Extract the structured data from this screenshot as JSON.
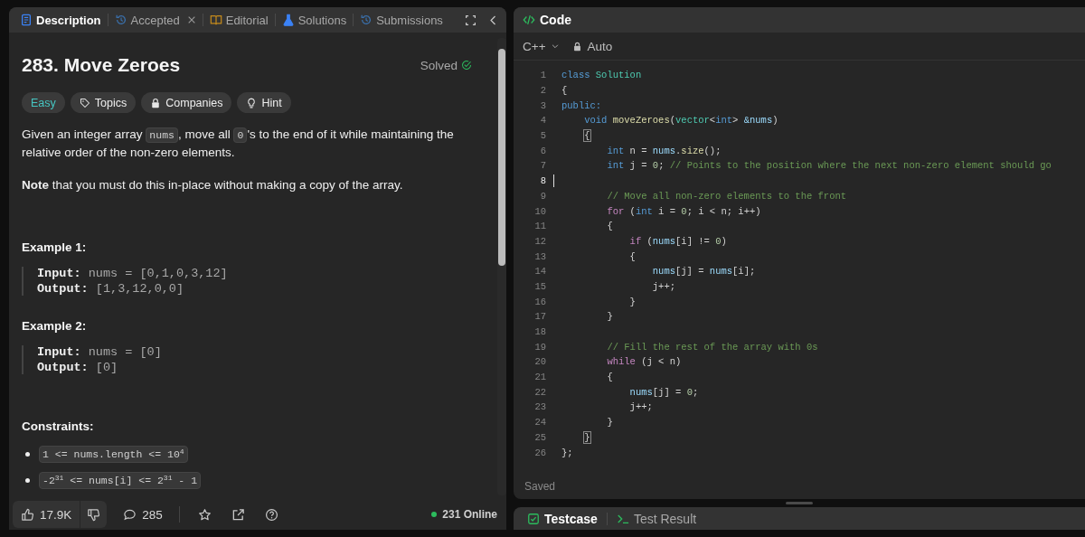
{
  "left_panel": {
    "tabs": [
      {
        "label": "Description",
        "selected": true,
        "closable": false
      },
      {
        "label": "Accepted",
        "selected": false,
        "closable": true
      },
      {
        "label": "Editorial",
        "selected": false,
        "closable": false
      },
      {
        "label": "Solutions",
        "selected": false,
        "closable": false
      },
      {
        "label": "Submissions",
        "selected": false,
        "closable": false
      }
    ],
    "problem": {
      "title": "283. Move Zeroes",
      "status": "Solved",
      "tags": [
        {
          "label": "Easy",
          "kind": "difficulty"
        },
        {
          "label": "Topics",
          "kind": "tag"
        },
        {
          "label": "Companies",
          "kind": "lock"
        },
        {
          "label": "Hint",
          "kind": "bulb"
        }
      ],
      "description": [
        {
          "kind": "paragraph",
          "segments": [
            {
              "kind": "text",
              "text": "Given an integer array "
            },
            {
              "kind": "code",
              "text": "nums"
            },
            {
              "kind": "text",
              "text": ", move all "
            },
            {
              "kind": "code",
              "text": "0"
            },
            {
              "kind": "text",
              "text": "'s to the end of it while maintaining the relative order of the non-zero elements."
            }
          ]
        },
        {
          "kind": "paragraph",
          "segments": [
            {
              "kind": "text",
              "text": "**Note** that you must do this in-place without making a copy of the array."
            }
          ]
        }
      ],
      "examples": [
        {
          "title": "Example 1:",
          "lines": [
            {
              "label": "Input:",
              "value": "nums = [0,1,0,3,12]"
            },
            {
              "label": "Output:",
              "value": "[1,3,12,0,0]"
            }
          ]
        },
        {
          "title": "Example 2:",
          "lines": [
            {
              "label": "Input:",
              "value": "nums = [0]"
            },
            {
              "label": "Output:",
              "value": "[0]"
            }
          ]
        }
      ],
      "constraints_title": "Constraints:",
      "constraints": [
        "1 <= nums.length <= 10$^{4}$",
        "-2$^{31}$ <= nums[i] <= 2$^{31}$ - 1"
      ]
    },
    "footer": {
      "likes": "17.9K",
      "comments": "285",
      "online": "231 Online"
    }
  },
  "code_panel": {
    "title": "Code",
    "language": "C++",
    "mode": "Auto",
    "status": "Saved",
    "lines": [
      {
        "number": "1",
        "active": false,
        "tokens": [
          {
            "kind": "keyword",
            "text": "class"
          },
          {
            "kind": "type",
            "text": " Solution"
          }
        ]
      },
      {
        "number": "2",
        "active": false,
        "tokens": [
          {
            "kind": "plain",
            "text": "{"
          }
        ]
      },
      {
        "number": "3",
        "active": false,
        "tokens": [
          {
            "kind": "keyword",
            "text": "public:"
          }
        ],
        "children": [
          {
            "number": "4",
            "active": false,
            "tokens": [
              {
                "kind": "keyword",
                "text": "void"
              },
              {
                "kind": "function",
                "text": " moveZeroes"
              },
              {
                "kind": "plain",
                "text": "("
              },
              {
                "kind": "type",
                "text": "vector"
              },
              {
                "kind": "plain",
                "text": "<"
              },
              {
                "kind": "keyword",
                "text": "int"
              },
              {
                "kind": "plain",
                "text": ">"
              },
              {
                "kind": "variable",
                "text": " &nums"
              },
              {
                "kind": "plain",
                "text": ")"
              }
            ]
          },
          {
            "number": "5",
            "active": false,
            "tokens": [
              {
                "kind": "match",
                "text": "{"
              }
            ],
            "children": [
              {
                "number": "6",
                "active": false,
                "tokens": [
                  {
                    "kind": "keyword",
                    "text": "int"
                  },
                  {
                    "kind": "plain",
                    "text": " n = "
                  },
                  {
                    "kind": "variable",
                    "text": "nums"
                  },
                  {
                    "kind": "plain",
                    "text": "."
                  },
                  {
                    "kind": "function",
                    "text": "size"
                  },
                  {
                    "kind": "plain",
                    "text": "();"
                  }
                ]
              },
              {
                "number": "7",
                "active": false,
                "tokens": [
                  {
                    "kind": "keyword",
                    "text": "int"
                  },
                  {
                    "kind": "plain",
                    "text": " j = "
                  },
                  {
                    "kind": "number",
                    "text": "0"
                  },
                  {
                    "kind": "plain",
                    "text": ";"
                  },
                  {
                    "kind": "comment",
                    "text": " // Points to the position where the next non-zero element should go"
                  }
                ]
              },
              {
                "number": "8",
                "active": true
              },
              {
                "number": "9",
                "active": false,
                "tokens": [
                  {
                    "kind": "comment",
                    "text": "// Move all non-zero elements to the front"
                  }
                ]
              },
              {
                "number": "10",
                "active": false,
                "tokens": [
                  {
                    "kind": "control",
                    "text": "for"
                  },
                  {
                    "kind": "plain",
                    "text": " ("
                  },
                  {
                    "kind": "keyword",
                    "text": "int"
                  },
                  {
                    "kind": "plain",
                    "text": " i = "
                  },
                  {
                    "kind": "number",
                    "text": "0"
                  },
                  {
                    "kind": "plain",
                    "text": "; i < n; i++)"
                  }
                ]
              },
              {
                "number": "11",
                "active": false,
                "tokens": [
                  {
                    "kind": "plain",
                    "text": "{"
                  }
                ],
                "children": [
                  {
                    "number": "12",
                    "active": false,
                    "tokens": [
                      {
                        "kind": "control",
                        "text": "if"
                      },
                      {
                        "kind": "plain",
                        "text": " ("
                      },
                      {
                        "kind": "variable",
                        "text": "nums"
                      },
                      {
                        "kind": "plain",
                        "text": "[i] != "
                      },
                      {
                        "kind": "number",
                        "text": "0"
                      },
                      {
                        "kind": "plain",
                        "text": ")"
                      }
                    ]
                  },
                  {
                    "number": "13",
                    "active": false,
                    "tokens": [
                      {
                        "kind": "plain",
                        "text": "{"
                      }
                    ],
                    "children": [
                      {
                        "number": "14",
                        "active": false,
                        "tokens": [
                          {
                            "kind": "variable",
                            "text": "nums"
                          },
                          {
                            "kind": "plain",
                            "text": "[j] = "
                          },
                          {
                            "kind": "variable",
                            "text": "nums"
                          },
                          {
                            "kind": "plain",
                            "text": "[i];"
                          }
                        ]
                      },
                      {
                        "number": "15",
                        "active": false,
                        "tokens": [
                          {
                            "kind": "plain",
                            "text": "j++;"
                          }
                        ]
                      }
                    ]
                  },
                  {
                    "number": "16",
                    "active": false,
                    "tokens": [
                      {
                        "kind": "plain",
                        "text": "}"
                      }
                    ]
                  }
                ]
              },
              {
                "number": "17",
                "active": false,
                "tokens": [
                  {
                    "kind": "plain",
                    "text": "}"
                  }
                ]
              },
              {
                "number": "18",
                "active": false
              },
              {
                "number": "19",
                "active": false,
                "tokens": [
                  {
                    "kind": "comment",
                    "text": "// Fill the rest of the array with 0s"
                  }
                ]
              },
              {
                "number": "20",
                "active": false,
                "tokens": [
                  {
                    "kind": "control",
                    "text": "while"
                  },
                  {
                    "kind": "plain",
                    "text": " (j < n)"
                  }
                ]
              },
              {
                "number": "21",
                "active": false,
                "tokens": [
                  {
                    "kind": "plain",
                    "text": "{"
                  }
                ],
                "children": [
                  {
                    "number": "22",
                    "active": false,
                    "tokens": [
                      {
                        "kind": "variable",
                        "text": "nums"
                      },
                      {
                        "kind": "plain",
                        "text": "[j] = "
                      },
                      {
                        "kind": "number",
                        "text": "0"
                      },
                      {
                        "kind": "plain",
                        "text": ";"
                      }
                    ]
                  },
                  {
                    "number": "23",
                    "active": false,
                    "tokens": [
                      {
                        "kind": "plain",
                        "text": "j++;"
                      }
                    ]
                  }
                ]
              },
              {
                "number": "24",
                "active": false,
                "tokens": [
                  {
                    "kind": "plain",
                    "text": "}"
                  }
                ]
              }
            ]
          },
          {
            "number": "25",
            "active": false,
            "tokens": [
              {
                "kind": "match",
                "text": "}"
              }
            ]
          }
        ]
      },
      {
        "number": "26",
        "active": false,
        "tokens": [
          {
            "kind": "plain",
            "text": "};"
          }
        ]
      }
    ]
  },
  "bottom_panel": {
    "tabs": [
      {
        "label": "Testcase",
        "selected": true
      },
      {
        "label": "Test Result",
        "selected": false
      }
    ]
  }
}
